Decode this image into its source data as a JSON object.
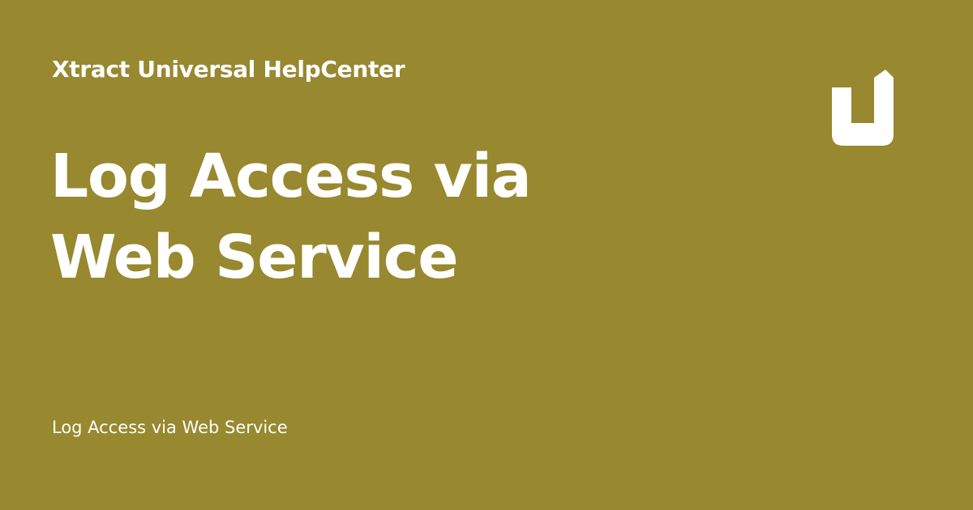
{
  "colors": {
    "background": "#98882F",
    "text": "#FFFFFF"
  },
  "header": {
    "site_name": "Xtract Universal HelpCenter"
  },
  "main": {
    "title": "Log Access via Web Service",
    "subtitle": "Log Access via Web Service"
  },
  "logo": {
    "icon": "u-logo-icon"
  }
}
